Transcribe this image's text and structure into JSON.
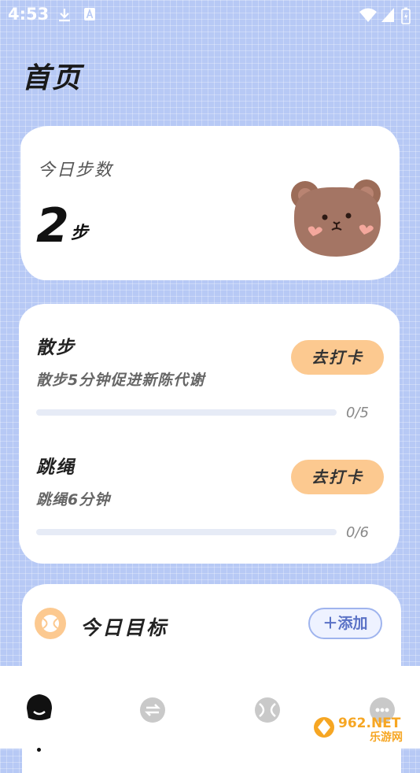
{
  "status_bar": {
    "time": "4:53"
  },
  "page": {
    "title": "首页"
  },
  "steps": {
    "label": "今日步数",
    "value": "2",
    "unit": "步"
  },
  "tasks": [
    {
      "title": "散步",
      "description": "散步5分钟促进新陈代谢",
      "button_label": "去打卡",
      "progress_text": "0/5",
      "progress_fraction": 0
    },
    {
      "title": "跳绳",
      "description": "跳绳6分钟",
      "button_label": "去打卡",
      "progress_text": "0/6",
      "progress_fraction": 0
    }
  ],
  "goals": {
    "title": "今日目标",
    "add_label": "＋添加"
  },
  "tabs": [
    {
      "icon": "home-icon",
      "active": true
    },
    {
      "icon": "exchange-icon",
      "active": false
    },
    {
      "icon": "ball-icon",
      "active": false
    },
    {
      "icon": "more-icon",
      "active": false
    }
  ],
  "watermark": {
    "text_top": "962.NET",
    "text_bottom": "乐游网"
  },
  "colors": {
    "background": "#b7c9f5",
    "accent": "#fcc990",
    "progress_track": "#e6ebf6",
    "add_button": "#5a72c6"
  }
}
